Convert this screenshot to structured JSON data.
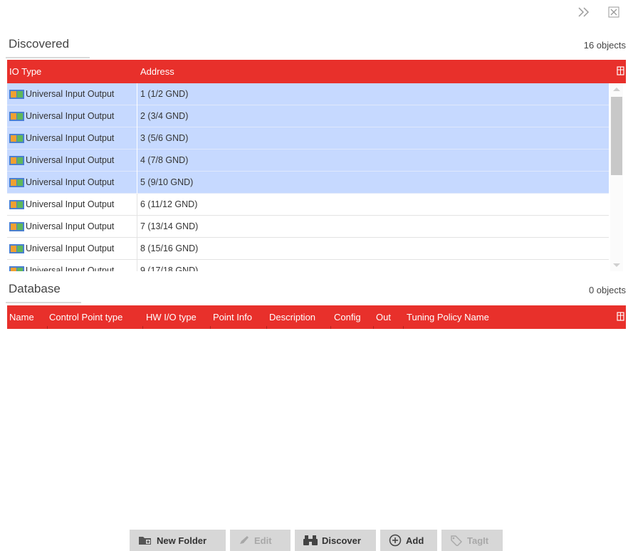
{
  "window_controls": {
    "expand_icon": "double-chevron-right-icon",
    "close_icon": "close-box-icon"
  },
  "discovered": {
    "title": "Discovered",
    "count": "16 objects",
    "columns": [
      "IO Type",
      "Address"
    ],
    "rows": [
      {
        "io_type": "Universal Input Output",
        "address": "1 (1/2 GND)",
        "selected": true
      },
      {
        "io_type": "Universal Input Output",
        "address": "2 (3/4 GND)",
        "selected": true
      },
      {
        "io_type": "Universal Input Output",
        "address": "3 (5/6 GND)",
        "selected": true
      },
      {
        "io_type": "Universal Input Output",
        "address": "4 (7/8 GND)",
        "selected": true
      },
      {
        "io_type": "Universal Input Output",
        "address": "5 (9/10 GND)",
        "selected": true
      },
      {
        "io_type": "Universal Input Output",
        "address": "6 (11/12 GND)",
        "selected": false
      },
      {
        "io_type": "Universal Input Output",
        "address": "7 (13/14 GND)",
        "selected": false
      },
      {
        "io_type": "Universal Input Output",
        "address": "8 (15/16 GND)",
        "selected": false
      },
      {
        "io_type": "Universal Input Output",
        "address": "9 (17/18 GND)",
        "selected": false
      }
    ]
  },
  "database": {
    "title": "Database",
    "count": "0 objects",
    "columns": [
      "Name",
      "Control Point type",
      "HW I/O type",
      "Point Info",
      "Description",
      "Config",
      "Out",
      "Tuning Policy Name"
    ]
  },
  "toolbar": {
    "new_folder": "New Folder",
    "edit": "Edit",
    "discover": "Discover",
    "add": "Add",
    "tagit": "TagIt"
  },
  "colors": {
    "accent": "#e8302b",
    "selected_row": "#c6d9ff",
    "button_bg": "#d7d7d7"
  }
}
